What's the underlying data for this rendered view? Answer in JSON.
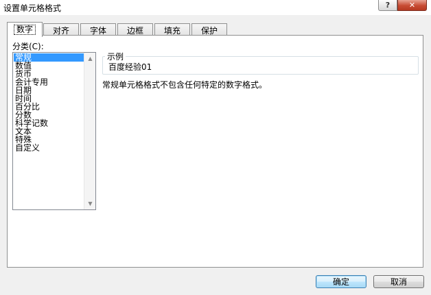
{
  "window": {
    "title": "设置单元格格式",
    "help_glyph": "?",
    "close_glyph": "✕"
  },
  "tabs": [
    {
      "label": "数字",
      "active": true
    },
    {
      "label": "对齐",
      "active": false
    },
    {
      "label": "字体",
      "active": false
    },
    {
      "label": "边框",
      "active": false
    },
    {
      "label": "填充",
      "active": false
    },
    {
      "label": "保护",
      "active": false
    }
  ],
  "category": {
    "label": "分类(C):",
    "items": [
      "常规",
      "数值",
      "货币",
      "会计专用",
      "日期",
      "时间",
      "百分比",
      "分数",
      "科学记数",
      "文本",
      "特殊",
      "自定义"
    ],
    "selected_index": 0
  },
  "sample": {
    "legend": "示例",
    "value": "百度经验01"
  },
  "description": "常规单元格格式不包含任何特定的数字格式。",
  "buttons": {
    "ok": "确定",
    "cancel": "取消"
  },
  "colors": {
    "selection": "#3399ff",
    "close_button": "#c74b33",
    "default_button_border": "#3c7fb1"
  }
}
